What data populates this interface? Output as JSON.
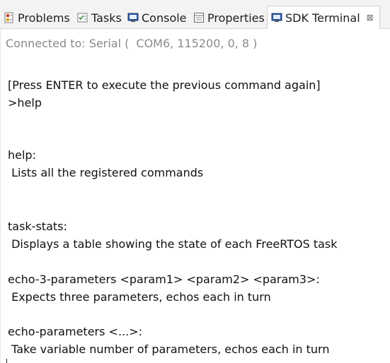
{
  "tabs": [
    {
      "label": "Problems",
      "icon": "problems-icon"
    },
    {
      "label": "Tasks",
      "icon": "tasks-icon"
    },
    {
      "label": "Console",
      "icon": "console-icon"
    },
    {
      "label": "Properties",
      "icon": "properties-icon"
    },
    {
      "label": "SDK Terminal",
      "icon": "sdk-terminal-icon",
      "active": true,
      "close_glyph": "⊠"
    }
  ],
  "status": {
    "connected_label": "Connected to: Serial (",
    "connection_params": "COM6, 115200, 0, 8 )"
  },
  "terminal_lines": [
    "[Press ENTER to execute the previous command again]",
    ">help",
    "help:",
    " Lists all the registered commands",
    "task-stats:",
    " Displays a table showing the state of each FreeRTOS task",
    "echo-3-parameters <param1> <param2> <param3>:",
    " Expects three parameters, echos each in turn",
    "echo-parameters <...>:",
    " Take variable number of parameters, echos each in turn"
  ],
  "colors": {
    "tabbar_bg": "#f3f3f3",
    "status_text": "#8a8a8a",
    "terminal_text": "#111111"
  }
}
